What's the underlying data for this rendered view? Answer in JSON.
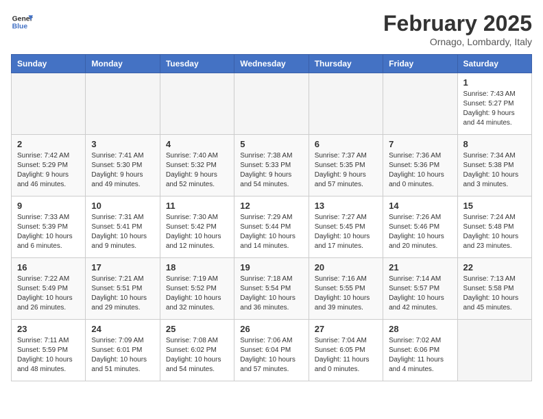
{
  "header": {
    "logo": {
      "line1": "General",
      "line2": "Blue"
    },
    "title": "February 2025",
    "location": "Ornago, Lombardy, Italy"
  },
  "weekdays": [
    "Sunday",
    "Monday",
    "Tuesday",
    "Wednesday",
    "Thursday",
    "Friday",
    "Saturday"
  ],
  "weeks": [
    [
      {
        "day": "",
        "info": ""
      },
      {
        "day": "",
        "info": ""
      },
      {
        "day": "",
        "info": ""
      },
      {
        "day": "",
        "info": ""
      },
      {
        "day": "",
        "info": ""
      },
      {
        "day": "",
        "info": ""
      },
      {
        "day": "1",
        "info": "Sunrise: 7:43 AM\nSunset: 5:27 PM\nDaylight: 9 hours\nand 44 minutes."
      }
    ],
    [
      {
        "day": "2",
        "info": "Sunrise: 7:42 AM\nSunset: 5:29 PM\nDaylight: 9 hours\nand 46 minutes."
      },
      {
        "day": "3",
        "info": "Sunrise: 7:41 AM\nSunset: 5:30 PM\nDaylight: 9 hours\nand 49 minutes."
      },
      {
        "day": "4",
        "info": "Sunrise: 7:40 AM\nSunset: 5:32 PM\nDaylight: 9 hours\nand 52 minutes."
      },
      {
        "day": "5",
        "info": "Sunrise: 7:38 AM\nSunset: 5:33 PM\nDaylight: 9 hours\nand 54 minutes."
      },
      {
        "day": "6",
        "info": "Sunrise: 7:37 AM\nSunset: 5:35 PM\nDaylight: 9 hours\nand 57 minutes."
      },
      {
        "day": "7",
        "info": "Sunrise: 7:36 AM\nSunset: 5:36 PM\nDaylight: 10 hours\nand 0 minutes."
      },
      {
        "day": "8",
        "info": "Sunrise: 7:34 AM\nSunset: 5:38 PM\nDaylight: 10 hours\nand 3 minutes."
      }
    ],
    [
      {
        "day": "9",
        "info": "Sunrise: 7:33 AM\nSunset: 5:39 PM\nDaylight: 10 hours\nand 6 minutes."
      },
      {
        "day": "10",
        "info": "Sunrise: 7:31 AM\nSunset: 5:41 PM\nDaylight: 10 hours\nand 9 minutes."
      },
      {
        "day": "11",
        "info": "Sunrise: 7:30 AM\nSunset: 5:42 PM\nDaylight: 10 hours\nand 12 minutes."
      },
      {
        "day": "12",
        "info": "Sunrise: 7:29 AM\nSunset: 5:44 PM\nDaylight: 10 hours\nand 14 minutes."
      },
      {
        "day": "13",
        "info": "Sunrise: 7:27 AM\nSunset: 5:45 PM\nDaylight: 10 hours\nand 17 minutes."
      },
      {
        "day": "14",
        "info": "Sunrise: 7:26 AM\nSunset: 5:46 PM\nDaylight: 10 hours\nand 20 minutes."
      },
      {
        "day": "15",
        "info": "Sunrise: 7:24 AM\nSunset: 5:48 PM\nDaylight: 10 hours\nand 23 minutes."
      }
    ],
    [
      {
        "day": "16",
        "info": "Sunrise: 7:22 AM\nSunset: 5:49 PM\nDaylight: 10 hours\nand 26 minutes."
      },
      {
        "day": "17",
        "info": "Sunrise: 7:21 AM\nSunset: 5:51 PM\nDaylight: 10 hours\nand 29 minutes."
      },
      {
        "day": "18",
        "info": "Sunrise: 7:19 AM\nSunset: 5:52 PM\nDaylight: 10 hours\nand 32 minutes."
      },
      {
        "day": "19",
        "info": "Sunrise: 7:18 AM\nSunset: 5:54 PM\nDaylight: 10 hours\nand 36 minutes."
      },
      {
        "day": "20",
        "info": "Sunrise: 7:16 AM\nSunset: 5:55 PM\nDaylight: 10 hours\nand 39 minutes."
      },
      {
        "day": "21",
        "info": "Sunrise: 7:14 AM\nSunset: 5:57 PM\nDaylight: 10 hours\nand 42 minutes."
      },
      {
        "day": "22",
        "info": "Sunrise: 7:13 AM\nSunset: 5:58 PM\nDaylight: 10 hours\nand 45 minutes."
      }
    ],
    [
      {
        "day": "23",
        "info": "Sunrise: 7:11 AM\nSunset: 5:59 PM\nDaylight: 10 hours\nand 48 minutes."
      },
      {
        "day": "24",
        "info": "Sunrise: 7:09 AM\nSunset: 6:01 PM\nDaylight: 10 hours\nand 51 minutes."
      },
      {
        "day": "25",
        "info": "Sunrise: 7:08 AM\nSunset: 6:02 PM\nDaylight: 10 hours\nand 54 minutes."
      },
      {
        "day": "26",
        "info": "Sunrise: 7:06 AM\nSunset: 6:04 PM\nDaylight: 10 hours\nand 57 minutes."
      },
      {
        "day": "27",
        "info": "Sunrise: 7:04 AM\nSunset: 6:05 PM\nDaylight: 11 hours\nand 0 minutes."
      },
      {
        "day": "28",
        "info": "Sunrise: 7:02 AM\nSunset: 6:06 PM\nDaylight: 11 hours\nand 4 minutes."
      },
      {
        "day": "",
        "info": ""
      }
    ]
  ]
}
